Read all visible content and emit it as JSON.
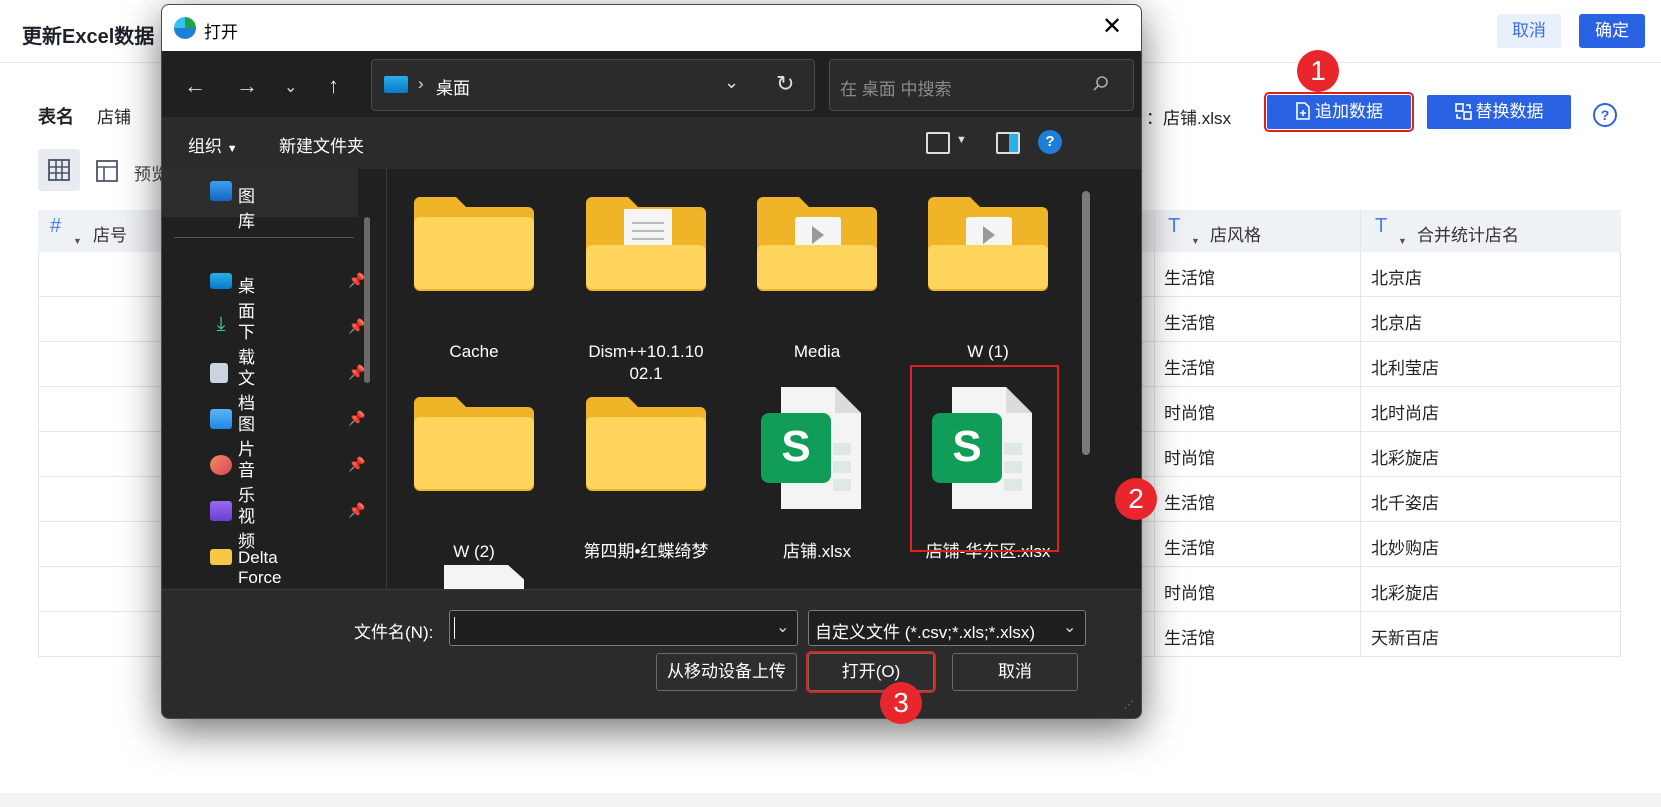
{
  "app": {
    "title": "更新Excel数据",
    "cancel_label": "取消",
    "ok_label": "确定",
    "table_name_label": "表名",
    "table_name_value": "店铺",
    "file_label": "：店铺.xlsx",
    "add_data_label": "追加数据",
    "replace_data_label": "替换数据",
    "help_glyph": "?",
    "preview_label": "预览",
    "columns": [
      {
        "type": "#",
        "name": "店号"
      },
      {
        "type": "T",
        "name": "店风格"
      },
      {
        "type": "T",
        "name": "合并统计店名"
      }
    ],
    "rows": [
      {
        "style": "生活馆",
        "name": "北京店"
      },
      {
        "style": "生活馆",
        "name": "北京店"
      },
      {
        "style": "生活馆",
        "name": "北利莹店"
      },
      {
        "style": "时尚馆",
        "name": "北时尚店"
      },
      {
        "style": "时尚馆",
        "name": "北彩旋店"
      },
      {
        "style": "生活馆",
        "name": "北千姿店"
      },
      {
        "style": "生活馆",
        "name": "北妙购店"
      },
      {
        "style": "时尚馆",
        "name": "北彩旋店"
      },
      {
        "style": "生活馆",
        "name": "天新百店"
      }
    ]
  },
  "dialog": {
    "title": "打开",
    "path_separator": "›",
    "path": "桌面",
    "search_placeholder": "在 桌面 中搜索",
    "organize_label": "组织",
    "new_folder_label": "新建文件夹",
    "sidebar": [
      {
        "label": "图库",
        "icon": "gallery-icon",
        "pinned": false
      },
      {
        "label": "桌面",
        "icon": "desktop-icon",
        "pinned": true
      },
      {
        "label": "下载",
        "icon": "download-icon",
        "pinned": true
      },
      {
        "label": "文档",
        "icon": "document-icon",
        "pinned": true
      },
      {
        "label": "图片",
        "icon": "pictures-icon",
        "pinned": true
      },
      {
        "label": "音乐",
        "icon": "music-icon",
        "pinned": true
      },
      {
        "label": "视频",
        "icon": "video-icon",
        "pinned": true
      },
      {
        "label": "Delta Force",
        "icon": "folder-icon",
        "pinned": false
      }
    ],
    "files": [
      {
        "name": "Cache",
        "kind": "folder"
      },
      {
        "name": "Dism++10.1.10\n02.1",
        "kind": "folder-doc"
      },
      {
        "name": "Media",
        "kind": "folder-video"
      },
      {
        "name": "W (1)",
        "kind": "folder-video"
      },
      {
        "name": "W (2)",
        "kind": "folder"
      },
      {
        "name": "第四期•红蝶绮梦",
        "kind": "folder"
      },
      {
        "name": "店铺.xlsx",
        "kind": "sheet"
      },
      {
        "name": "店铺-华东区.xlsx",
        "kind": "sheet"
      }
    ],
    "filename_label": "文件名(N):",
    "filename_value": "",
    "filetype_value": "自定义文件 (*.csv;*.xls;*.xlsx)",
    "upload_mobile_label": "从移动设备上传",
    "open_label": "打开(O)",
    "cancel_label": "取消"
  },
  "annotations": [
    "1",
    "2",
    "3"
  ],
  "colors": {
    "accent": "#2a62e4",
    "highlight": "#e02020",
    "badge": "#e8262b",
    "dialog_bg": "#202020"
  }
}
